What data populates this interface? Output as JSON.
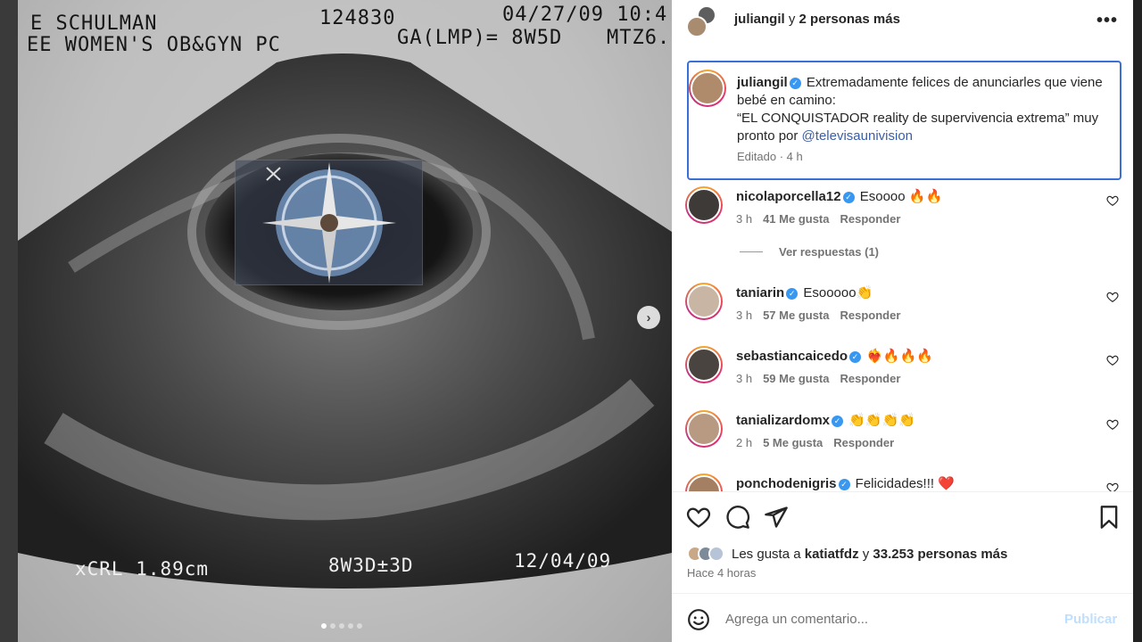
{
  "scan": {
    "name": "E SCHULMAN",
    "clinic": "EE WOMEN'S OB&GYN PC",
    "id": "124830",
    "datetime": "04/27/09 10:4",
    "ga": "GA(LMP)= 8W5D",
    "mtz": "MTZ6.",
    "crl": "xCRL 1.89cm",
    "ga_scan": "8W3D±3D",
    "date": "12/04/09",
    "slides": 5,
    "active_slide": 0
  },
  "header": {
    "user": "juliangil",
    "connector": " y ",
    "others": "2 personas más"
  },
  "caption": {
    "user": "juliangil",
    "text1": "Extremadamente felices de anunciarles que viene bebé en camino:",
    "text2": "“EL CONQUISTADOR reality de supervivencia extrema” muy pronto por ",
    "mention": "@televisaunivision",
    "edited": "Editado · 4 h"
  },
  "comments": [
    {
      "user": "nicolaporcella12",
      "text": "Esoooo 🔥🔥",
      "time": "3 h",
      "likes": "41 Me gusta",
      "reply": "Responder"
    },
    {
      "user": "taniarin",
      "text": "Esooooo👏",
      "time": "3 h",
      "likes": "57 Me gusta",
      "reply": "Responder"
    },
    {
      "user": "sebastiancaicedo",
      "text": "❤️‍🔥🔥🔥🔥",
      "time": "3 h",
      "likes": "59 Me gusta",
      "reply": "Responder"
    },
    {
      "user": "tanializardomx",
      "text": "👏👏👏👏",
      "time": "2 h",
      "likes": "5 Me gusta",
      "reply": "Responder"
    },
    {
      "user": "ponchodenigris",
      "text": "Felicidades!!! ❤️",
      "time": "",
      "likes": "",
      "reply": ""
    }
  ],
  "view_replies": "Ver respuestas (1)",
  "likes": {
    "prefix": "Les gusta a ",
    "user": "katiatfdz",
    "mid": " y ",
    "count": "33.253 personas más"
  },
  "time_ago": "Hace 4 horas",
  "comment_box": {
    "placeholder": "Agrega un comentario...",
    "publish": "Publicar"
  },
  "colors": {
    "verified": "#3897f0",
    "mention": "#3b5ea8",
    "focus_border": "#3a6fd8",
    "publish_disabled": "#c0dffd"
  }
}
